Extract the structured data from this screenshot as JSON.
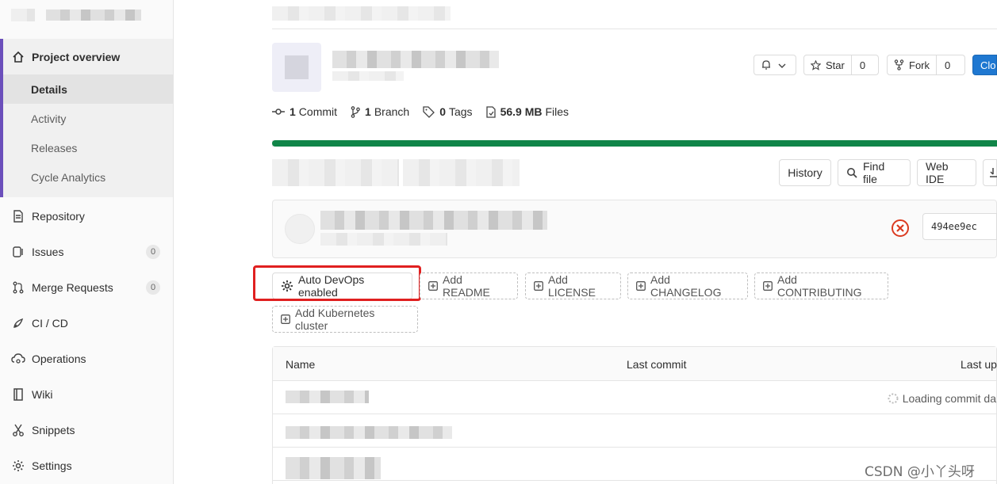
{
  "sidebar": {
    "overview": "Project overview",
    "sub_items": [
      "Details",
      "Activity",
      "Releases",
      "Cycle Analytics"
    ],
    "items": [
      {
        "label": "Repository",
        "icon": "file-icon"
      },
      {
        "label": "Issues",
        "icon": "issues-icon",
        "count": "0"
      },
      {
        "label": "Merge Requests",
        "icon": "merge-request-icon",
        "count": "0"
      },
      {
        "label": "CI / CD",
        "icon": "rocket-icon"
      },
      {
        "label": "Operations",
        "icon": "cloud-gear-icon"
      },
      {
        "label": "Wiki",
        "icon": "book-icon"
      },
      {
        "label": "Snippets",
        "icon": "scissors-icon"
      },
      {
        "label": "Settings",
        "icon": "gear-icon"
      }
    ]
  },
  "header": {
    "star_label": "Star",
    "star_count": "0",
    "fork_label": "Fork",
    "fork_count": "0",
    "clone_label": "Clo"
  },
  "stats": {
    "commits_count": "1",
    "commits_label": "Commit",
    "branches_count": "1",
    "branches_label": "Branch",
    "tags_count": "0",
    "tags_label": "Tags",
    "files_size": "56.9 MB",
    "files_label": "Files"
  },
  "toolbar": {
    "history": "History",
    "find_file": "Find file",
    "web_ide": "Web IDE"
  },
  "commit": {
    "sha": "494ee9ec",
    "status_color": "#db3b21"
  },
  "actions": {
    "auto_devops": "Auto DevOps enabled",
    "add_readme": "Add README",
    "add_license": "Add LICENSE",
    "add_changelog": "Add CHANGELOG",
    "add_contributing": "Add CONTRIBUTING",
    "add_k8s": "Add Kubernetes cluster"
  },
  "table": {
    "col_name": "Name",
    "col_last_commit": "Last commit",
    "col_last_update": "Last upd",
    "loading": "Loading commit da"
  },
  "watermark": "CSDN @小丫头呀",
  "colors": {
    "accent": "#6b4fbb",
    "progress": "#108548",
    "primary": "#1f78d1",
    "highlight": "#e02020"
  }
}
